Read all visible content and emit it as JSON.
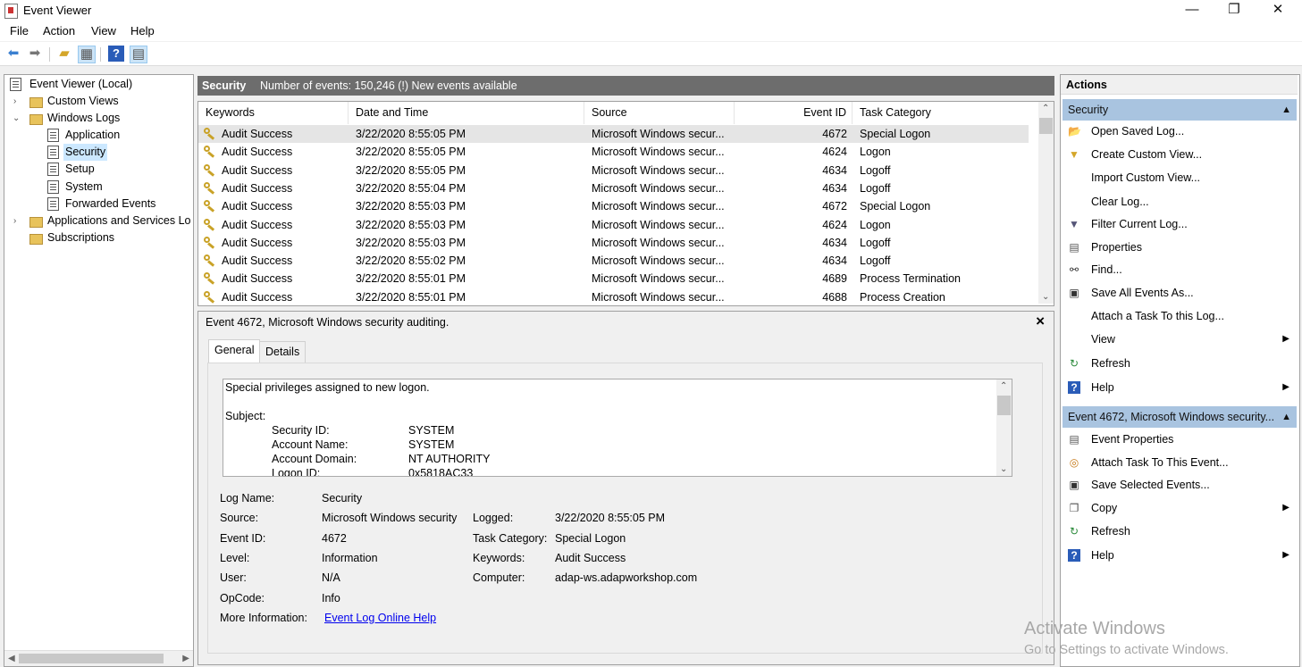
{
  "window": {
    "title": "Event Viewer",
    "minimize": "—",
    "maximize": "❐",
    "close": "✕"
  },
  "menu": [
    "File",
    "Action",
    "View",
    "Help"
  ],
  "tree": {
    "root": "Event Viewer (Local)",
    "custom_views": "Custom Views",
    "windows_logs": "Windows Logs",
    "logs": [
      "Application",
      "Security",
      "Setup",
      "System",
      "Forwarded Events"
    ],
    "apps_services": "Applications and Services Lo",
    "subscriptions": "Subscriptions"
  },
  "center": {
    "log_name": "Security",
    "summary": "Number of events: 150,246 (!) New events available"
  },
  "table": {
    "columns": [
      "Keywords",
      "Date and Time",
      "Source",
      "Event ID",
      "Task Category"
    ],
    "rows": [
      [
        "Audit Success",
        "3/22/2020 8:55:05 PM",
        "Microsoft Windows secur...",
        "4672",
        "Special Logon"
      ],
      [
        "Audit Success",
        "3/22/2020 8:55:05 PM",
        "Microsoft Windows secur...",
        "4624",
        "Logon"
      ],
      [
        "Audit Success",
        "3/22/2020 8:55:05 PM",
        "Microsoft Windows secur...",
        "4634",
        "Logoff"
      ],
      [
        "Audit Success",
        "3/22/2020 8:55:04 PM",
        "Microsoft Windows secur...",
        "4634",
        "Logoff"
      ],
      [
        "Audit Success",
        "3/22/2020 8:55:03 PM",
        "Microsoft Windows secur...",
        "4672",
        "Special Logon"
      ],
      [
        "Audit Success",
        "3/22/2020 8:55:03 PM",
        "Microsoft Windows secur...",
        "4624",
        "Logon"
      ],
      [
        "Audit Success",
        "3/22/2020 8:55:03 PM",
        "Microsoft Windows secur...",
        "4634",
        "Logoff"
      ],
      [
        "Audit Success",
        "3/22/2020 8:55:02 PM",
        "Microsoft Windows secur...",
        "4634",
        "Logoff"
      ],
      [
        "Audit Success",
        "3/22/2020 8:55:01 PM",
        "Microsoft Windows secur...",
        "4689",
        "Process Termination"
      ],
      [
        "Audit Success",
        "3/22/2020 8:55:01 PM",
        "Microsoft Windows secur...",
        "4688",
        "Process Creation"
      ]
    ]
  },
  "detail": {
    "title": "Event 4672, Microsoft Windows security auditing.",
    "tabs": [
      "General",
      "Details"
    ],
    "description": {
      "line1": "Special privileges assigned to new logon.",
      "subject": "Subject:",
      "fields": [
        [
          "Security ID:",
          "SYSTEM"
        ],
        [
          "Account Name:",
          "SYSTEM"
        ],
        [
          "Account Domain:",
          "NT AUTHORITY"
        ],
        [
          "Logon ID:",
          "0x5818AC33"
        ]
      ]
    },
    "props": {
      "log_name_label": "Log Name:",
      "log_name": "Security",
      "source_label": "Source:",
      "source": "Microsoft Windows security",
      "logged_label": "Logged:",
      "logged": "3/22/2020 8:55:05 PM",
      "event_id_label": "Event ID:",
      "event_id": "4672",
      "task_category_label": "Task Category:",
      "task_category": "Special Logon",
      "level_label": "Level:",
      "level": "Information",
      "keywords_label": "Keywords:",
      "keywords": "Audit Success",
      "user_label": "User:",
      "user": "N/A",
      "computer_label": "Computer:",
      "computer": "adap-ws.adapworkshop.com",
      "opcode_label": "OpCode:",
      "opcode": "Info",
      "more_info_label": "More Information:",
      "more_info_link": "Event Log Online Help"
    }
  },
  "actions": {
    "header": "Actions",
    "section1": "Security",
    "items1": [
      "Open Saved Log...",
      "Create Custom View...",
      "Import Custom View...",
      "Clear Log...",
      "Filter Current Log...",
      "Properties",
      "Find...",
      "Save All Events As...",
      "Attach a Task To this Log...",
      "View",
      "Refresh",
      "Help"
    ],
    "section2": "Event 4672, Microsoft Windows security...",
    "items2": [
      "Event Properties",
      "Attach Task To This Event...",
      "Save Selected Events...",
      "Copy",
      "Refresh",
      "Help"
    ]
  },
  "watermark": {
    "line1": "Activate Windows",
    "line2": "Go to Settings to activate Windows."
  }
}
